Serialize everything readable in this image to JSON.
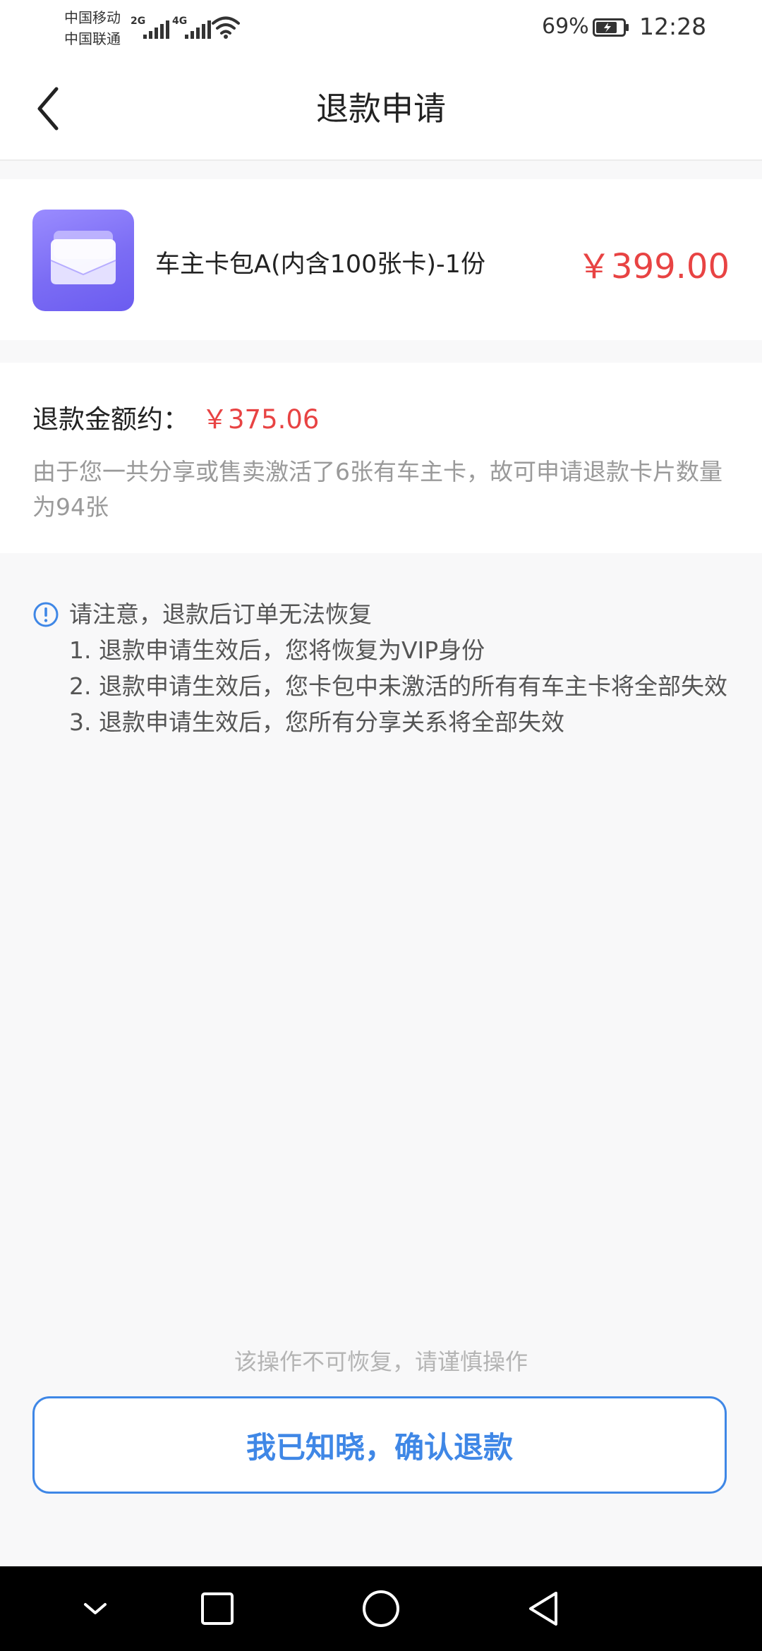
{
  "status_bar": {
    "carrier_1": "中国移动",
    "carrier_2": "中国联通",
    "net_1": "2G",
    "net_2": "4G",
    "battery": "69%",
    "time": "12:28",
    "icons": [
      "signal-icon",
      "wifi-icon",
      "battery-icon"
    ]
  },
  "header": {
    "title": "退款申请",
    "back_icon": "chevron-left-icon"
  },
  "product": {
    "icon": "envelope-icon",
    "name": "车主卡包A(内含100张卡)-1份",
    "price": "￥399.00"
  },
  "refund": {
    "label": "退款金额约：",
    "amount": "￥375.06",
    "description": "由于您一共分享或售卖激活了6张有车主卡，故可申请退款卡片数量为94张"
  },
  "notice": {
    "icon": "info-circle-icon",
    "title": "请注意，退款后订单无法恢复",
    "items": [
      " 1. 退款申请生效后，您将恢复为VIP身份",
      " 2. 退款申请生效后，您卡包中未激活的所有有车主卡将全部失效",
      " 3. 退款申请生效后，您所有分享关系将全部失效"
    ]
  },
  "footer": {
    "warning": "该操作不可恢复，请谨慎操作",
    "confirm_label": "我已知晓，确认退款"
  },
  "system_nav": {
    "icons": [
      "chevron-down-icon",
      "square-icon",
      "circle-icon",
      "triangle-back-icon"
    ]
  },
  "colors": {
    "price": "#e84343",
    "accent": "#3f87e6",
    "muted": "#9a9a9a",
    "background": "#f8f8f9",
    "product_icon": "#7b6cf4"
  }
}
